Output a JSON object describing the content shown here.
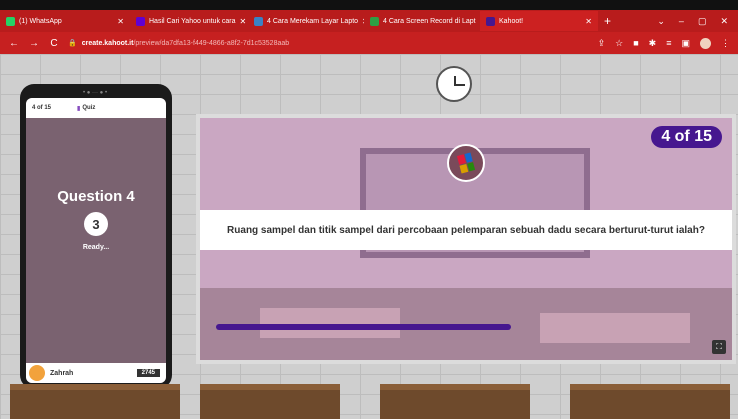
{
  "browser": {
    "tabs": [
      {
        "title": "(1) WhatsApp",
        "favicon_color": "#25d366",
        "active": false
      },
      {
        "title": "Hasil Cari Yahoo untuk cara",
        "favicon_color": "#6001d2",
        "active": false
      },
      {
        "title": "4 Cara Merekam Layar Lapto",
        "favicon_color": "#3b82c4",
        "active": false
      },
      {
        "title": "4 Cara Screen Record di Lapt",
        "favicon_color": "#2f9e44",
        "active": false
      },
      {
        "title": "Kahoot!",
        "favicon_color": "#46178f",
        "active": true
      }
    ],
    "url_host": "create.kahoot.it",
    "url_path": "/preview/da7dfa13-f449-4866-a8f2-7d1c53528aab"
  },
  "game": {
    "counter": "4 of 15",
    "question": "Ruang sampel dan titik sampel dari percobaan pelemparan sebuah dadu secara berturut-turut ialah?",
    "time_progress": 0.58
  },
  "phone": {
    "question_count": "4 of 15",
    "quiz_label": "Quiz",
    "question_title": "Question 4",
    "countdown": "3",
    "ready_label": "Ready...",
    "player_name": "Zahrah",
    "score": "2745"
  },
  "colors": {
    "tabbar": "#b81c1c",
    "kahoot_purple": "#46178f"
  }
}
